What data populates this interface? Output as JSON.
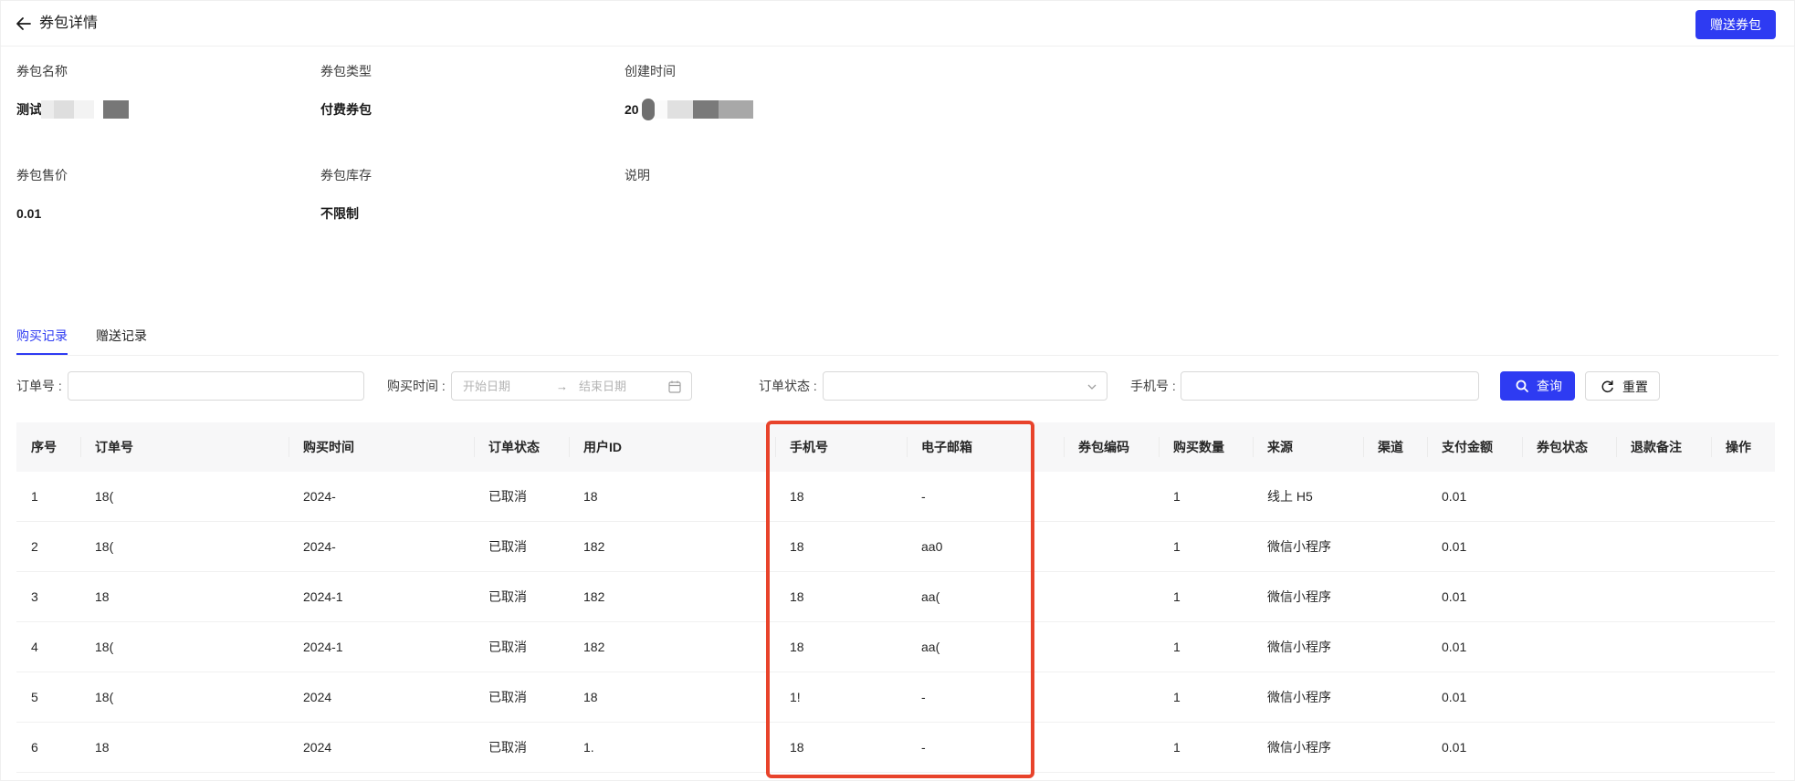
{
  "header": {
    "title": "券包详情",
    "gift_button": "赠送券包"
  },
  "info": {
    "name_label": "券包名称",
    "name_value": "测试",
    "type_label": "券包类型",
    "type_value": "付费券包",
    "created_label": "创建时间",
    "created_value": "20",
    "price_label": "券包售价",
    "price_value": "0.01",
    "stock_label": "券包库存",
    "stock_value": "不限制",
    "desc_label": "说明"
  },
  "tabs": {
    "purchase": "购买记录",
    "gift": "赠送记录"
  },
  "filters": {
    "order_label": "订单号 :",
    "time_label": "购买时间 :",
    "start_placeholder": "开始日期",
    "arrow": "→",
    "end_placeholder": "结束日期",
    "status_label": "订单状态 :",
    "phone_label": "手机号 :",
    "query": "查询",
    "reset": "重置"
  },
  "table": {
    "headers": [
      "序号",
      "订单号",
      "购买时间",
      "订单状态",
      "用户ID",
      "手机号",
      "电子邮箱",
      "券包编码",
      "购买数量",
      "来源",
      "渠道",
      "支付金额",
      "券包状态",
      "退款备注",
      "操作"
    ],
    "rows": [
      [
        "1",
        "18(",
        "2024-",
        "已取消",
        "18",
        "18",
        "-",
        "",
        "1",
        "线上 H5",
        "",
        "0.01",
        "",
        "",
        ""
      ],
      [
        "2",
        "18(",
        "2024-",
        "已取消",
        "182",
        "18",
        "aa0",
        "",
        "1",
        "微信小程序",
        "",
        "0.01",
        "",
        "",
        ""
      ],
      [
        "3",
        "18",
        "2024-1",
        "已取消",
        "182",
        "18",
        "aa(",
        "",
        "1",
        "微信小程序",
        "",
        "0.01",
        "",
        "",
        ""
      ],
      [
        "4",
        "18(",
        "2024-1",
        "已取消",
        "182",
        "18",
        "aa(",
        "",
        "1",
        "微信小程序",
        "",
        "0.01",
        "",
        "",
        ""
      ],
      [
        "5",
        "18(",
        "2024",
        "已取消",
        "18",
        "1!",
        "-",
        "",
        "1",
        "微信小程序",
        "",
        "0.01",
        "",
        "",
        ""
      ],
      [
        "6",
        "18",
        "2024",
        "已取消",
        "1.",
        "18",
        "-",
        "",
        "1",
        "微信小程序",
        "",
        "0.01",
        "",
        "",
        ""
      ]
    ]
  },
  "colors": {
    "primary": "#2e3bf2",
    "highlight": "#e8432b"
  },
  "icons": {
    "back": "arrow-left-icon",
    "search": "search-icon",
    "reset": "refresh-icon",
    "calendar": "calendar-icon",
    "dropdown": "chevron-down-icon"
  }
}
